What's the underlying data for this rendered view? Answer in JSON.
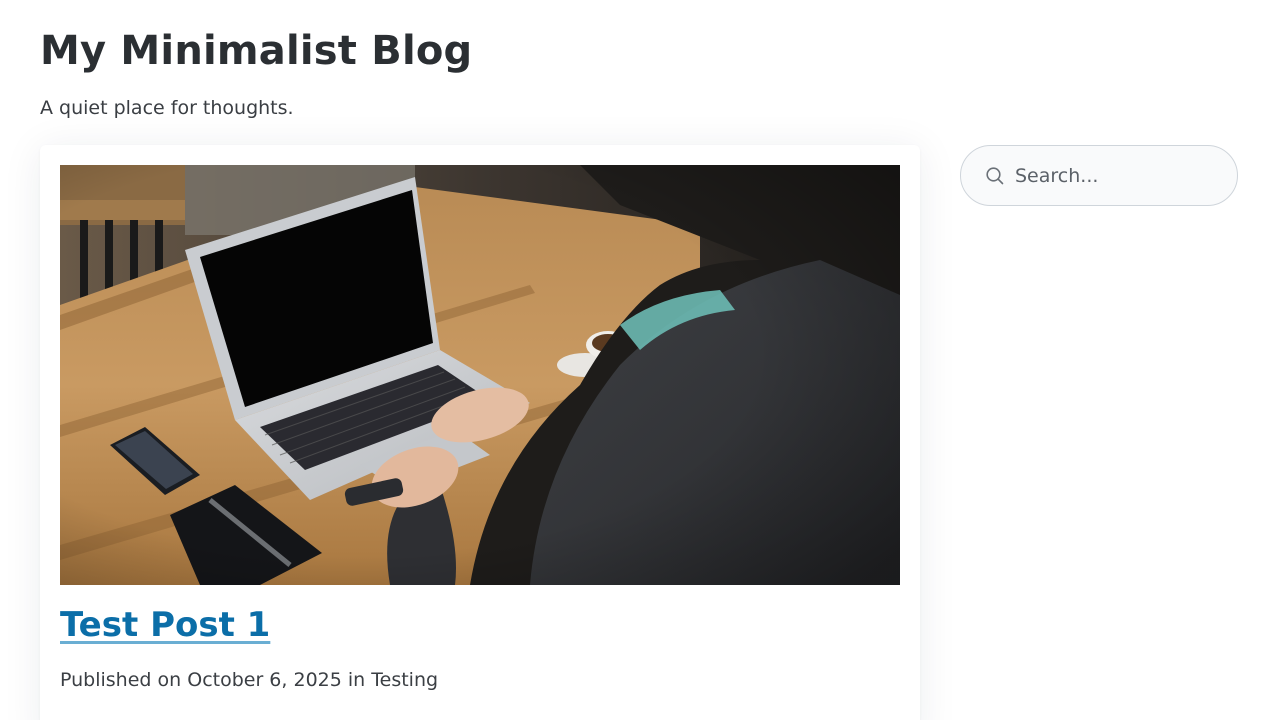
{
  "site": {
    "title": "My Minimalist Blog",
    "tagline": "A quiet place for thoughts."
  },
  "post": {
    "image_alt": "Person typing on a laptop at a wooden table",
    "title": "Test Post 1",
    "meta_prefix": "Published on",
    "date": "October 6, 2025",
    "meta_in": "in",
    "category": "Testing"
  },
  "search": {
    "placeholder": "Search...",
    "icon": "search-icon"
  },
  "colors": {
    "link": "#0b6ea8",
    "text": "#2b2f33",
    "search_border": "#cfd5db"
  }
}
